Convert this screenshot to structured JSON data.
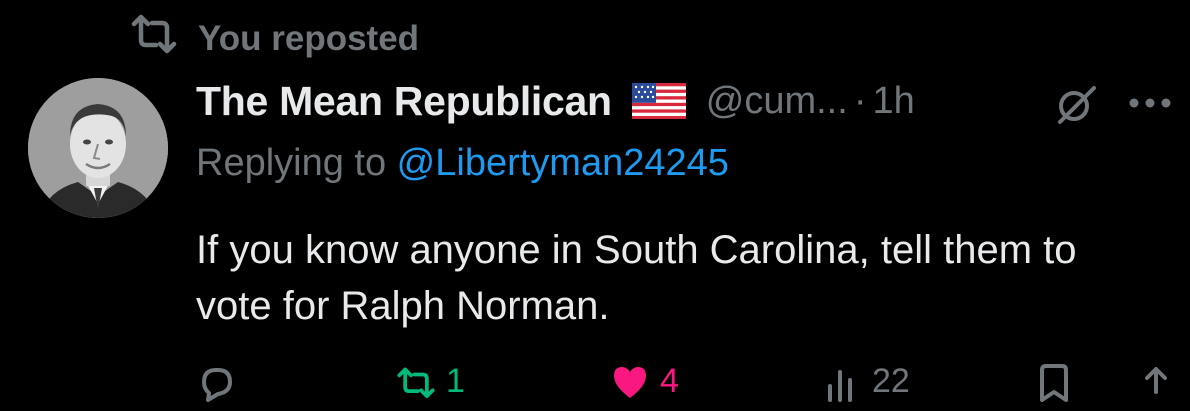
{
  "repost_banner": {
    "icon": "repost-icon",
    "text": "You reposted"
  },
  "author": {
    "display_name": "The Mean Republican",
    "flag_icon": "us-flag-icon",
    "handle": "@cum...",
    "separator": "·",
    "time": "1h"
  },
  "reply": {
    "prefix": "Replying to ",
    "mention": "@Libertyman24245"
  },
  "tweet": {
    "text": "If you know anyone in South Carolina, tell them to vote for Ralph Norman."
  },
  "actions": {
    "reply_count": "",
    "repost_count": "1",
    "like_count": "4",
    "views_count": "22"
  },
  "colors": {
    "background": "#000000",
    "primary_text": "#e7e9ea",
    "secondary_text": "#71767b",
    "link": "#1d9bf0",
    "repost_active": "#00ba7c",
    "like_active": "#f91880"
  }
}
